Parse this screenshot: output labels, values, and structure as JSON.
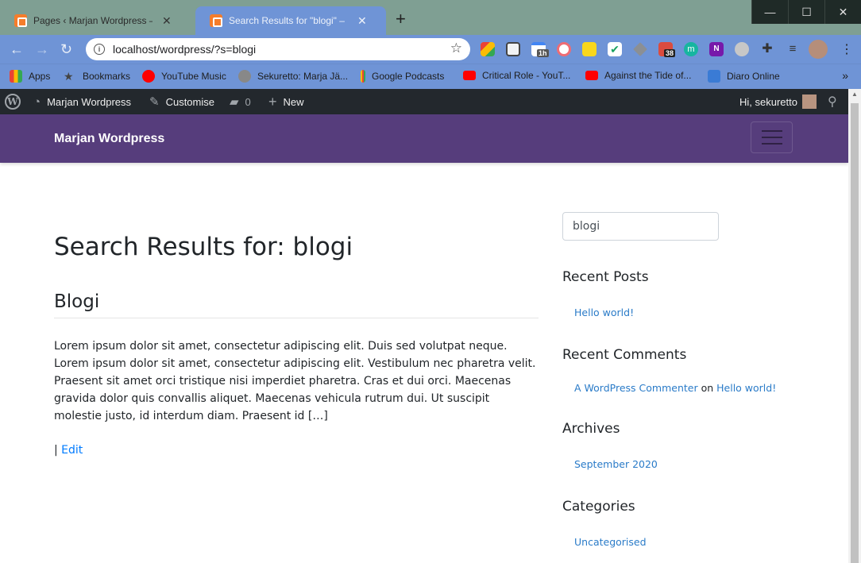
{
  "browser": {
    "tabs": [
      {
        "title": "Pages ‹ Marjan Wordpress — Wo",
        "close": "✕"
      },
      {
        "title": "Search Results for \"blogi\" – Marja",
        "close": "✕"
      }
    ],
    "new_tab": "+",
    "window_controls": {
      "minimize": "—",
      "maximize": "☐",
      "close": "✕"
    },
    "url": "localhost/wordpress/?s=blogi",
    "extension_badge": "38",
    "extension_badge_small": "1h",
    "bookmarks": [
      {
        "label": "Apps",
        "icon": "apps-grid-icon",
        "color": "#e8453c"
      },
      {
        "label": "Bookmarks",
        "icon": "star-icon",
        "color": "#555555"
      },
      {
        "label": "YouTube Music",
        "icon": "youtube-music-icon",
        "color": "#ff0000"
      },
      {
        "label": "Sekuretto: Marja Jä...",
        "icon": "globe-icon",
        "color": "#555555"
      },
      {
        "label": "Google Podcasts",
        "icon": "google-podcasts-icon",
        "color": "#4285f4"
      },
      {
        "label": "Critical Role - YouT...",
        "icon": "youtube-icon",
        "color": "#ff0000"
      },
      {
        "label": "Against the Tide of...",
        "icon": "youtube-icon",
        "color": "#ff0000"
      },
      {
        "label": "Diaro Online",
        "icon": "diaro-icon",
        "color": "#3a7bd5"
      }
    ],
    "bookmarks_more": "»"
  },
  "adminbar": {
    "site_name": "Marjan Wordpress",
    "customise": "Customise",
    "comments_count": "0",
    "new_label": "New",
    "greeting": "Hi, sekuretto"
  },
  "site": {
    "title": "Marjan Wordpress"
  },
  "main": {
    "page_title": "Search Results for: blogi",
    "post": {
      "title": "Blogi",
      "excerpt": "Lorem ipsum dolor sit amet, consectetur adipiscing elit. Duis sed volutpat neque. Lorem ipsum dolor sit amet, consectetur adipiscing elit. Vestibulum nec pharetra velit. Praesent sit amet orci tristique nisi imperdiet pharetra. Cras et dui orci. Maecenas gravida dolor quis convallis aliquet. Maecenas vehicula rutrum dui. Ut suscipit molestie justo, id interdum diam. Praesent id […]",
      "meta_sep": "| ",
      "edit_label": "Edit"
    }
  },
  "sidebar": {
    "search_value": "blogi",
    "recent_posts": {
      "title": "Recent Posts",
      "items": [
        "Hello world!"
      ]
    },
    "recent_comments": {
      "title": "Recent Comments",
      "author": "A WordPress Commenter",
      "on": " on ",
      "post": "Hello world!"
    },
    "archives": {
      "title": "Archives",
      "items": [
        "September 2020"
      ]
    },
    "categories": {
      "title": "Categories",
      "items": [
        "Uncategorised"
      ]
    }
  },
  "colors": {
    "header": "#563d7c",
    "adminbar": "#23282d",
    "link": "#007bff",
    "browser_frame": "#6f94d6"
  }
}
